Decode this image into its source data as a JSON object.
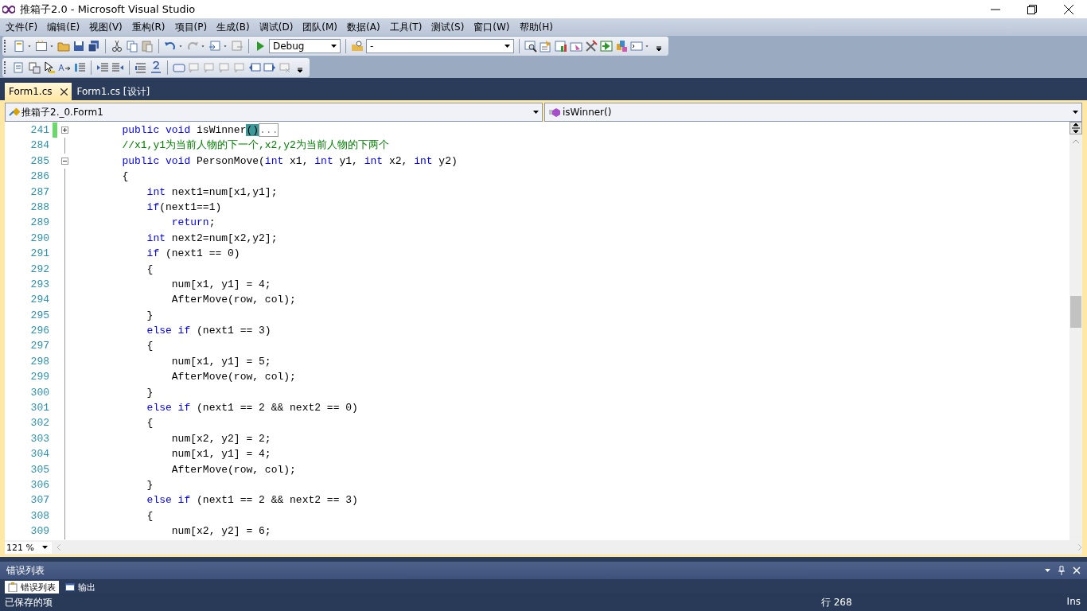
{
  "window": {
    "title": "推箱子2.0 - Microsoft Visual Studio"
  },
  "menu": [
    "文件(F)",
    "编辑(E)",
    "视图(V)",
    "重构(R)",
    "项目(P)",
    "生成(B)",
    "调试(D)",
    "团队(M)",
    "数据(A)",
    "工具(T)",
    "测试(S)",
    "窗口(W)",
    "帮助(H)"
  ],
  "toolbar": {
    "configuration": "Debug",
    "platform": "-"
  },
  "tabs": [
    {
      "label": "Form1.cs",
      "selected": true
    },
    {
      "label": "Form1.cs [设计]",
      "selected": false
    }
  ],
  "navigation": {
    "type": "推箱子2._0.Form1",
    "member": "isWinner()"
  },
  "editor": {
    "lines": [
      {
        "number": "241",
        "changed": true,
        "outlining": true,
        "expanded": false,
        "tokens": [
          {
            "kind": "keyword",
            "text": "        public void"
          },
          {
            "kind": "plain",
            "text": " isWinner"
          },
          {
            "kind": "match",
            "text": "()"
          },
          {
            "kind": "collapsed",
            "text": "..."
          }
        ]
      },
      {
        "number": "284",
        "changed": false,
        "outlining": false,
        "tokens": [
          {
            "kind": "comment",
            "text": "        //x1,y1为当前人物的下一个,x2,y2为当前人物的下两个"
          }
        ]
      },
      {
        "number": "285",
        "changed": false,
        "outlining": true,
        "expanded": true,
        "tokens": [
          {
            "kind": "keyword",
            "text": "        public void"
          },
          {
            "kind": "plain",
            "text": " PersonMove("
          },
          {
            "kind": "keyword",
            "text": "int"
          },
          {
            "kind": "plain",
            "text": " x1, "
          },
          {
            "kind": "keyword",
            "text": "int"
          },
          {
            "kind": "plain",
            "text": " y1, "
          },
          {
            "kind": "keyword",
            "text": "int"
          },
          {
            "kind": "plain",
            "text": " x2, "
          },
          {
            "kind": "keyword",
            "text": "int"
          },
          {
            "kind": "plain",
            "text": " y2)"
          }
        ]
      },
      {
        "number": "286",
        "changed": false,
        "outlining": false,
        "tokens": [
          {
            "kind": "plain",
            "text": "        {"
          }
        ]
      },
      {
        "number": "287",
        "changed": false,
        "outlining": false,
        "tokens": [
          {
            "kind": "keyword",
            "text": "            int"
          },
          {
            "kind": "plain",
            "text": " next1=num[x1,y1];"
          }
        ]
      },
      {
        "number": "288",
        "changed": false,
        "outlining": false,
        "tokens": [
          {
            "kind": "keyword",
            "text": "            if"
          },
          {
            "kind": "plain",
            "text": "(next1==1)"
          }
        ]
      },
      {
        "number": "289",
        "changed": false,
        "outlining": false,
        "tokens": [
          {
            "kind": "keyword",
            "text": "                return"
          },
          {
            "kind": "plain",
            "text": ";"
          }
        ]
      },
      {
        "number": "290",
        "changed": false,
        "outlining": false,
        "tokens": [
          {
            "kind": "keyword",
            "text": "            int"
          },
          {
            "kind": "plain",
            "text": " next2=num[x2,y2];"
          }
        ]
      },
      {
        "number": "291",
        "changed": false,
        "outlining": false,
        "tokens": [
          {
            "kind": "keyword",
            "text": "            if"
          },
          {
            "kind": "plain",
            "text": " (next1 == 0)"
          }
        ]
      },
      {
        "number": "292",
        "changed": false,
        "outlining": false,
        "tokens": [
          {
            "kind": "plain",
            "text": "            {"
          }
        ]
      },
      {
        "number": "293",
        "changed": false,
        "outlining": false,
        "tokens": [
          {
            "kind": "plain",
            "text": "                num[x1, y1] = 4;"
          }
        ]
      },
      {
        "number": "294",
        "changed": false,
        "outlining": false,
        "tokens": [
          {
            "kind": "plain",
            "text": "                AfterMove(row, col);"
          }
        ]
      },
      {
        "number": "295",
        "changed": false,
        "outlining": false,
        "tokens": [
          {
            "kind": "plain",
            "text": "            }"
          }
        ]
      },
      {
        "number": "296",
        "changed": false,
        "outlining": false,
        "tokens": [
          {
            "kind": "keyword",
            "text": "            else if"
          },
          {
            "kind": "plain",
            "text": " (next1 == 3)"
          }
        ]
      },
      {
        "number": "297",
        "changed": false,
        "outlining": false,
        "tokens": [
          {
            "kind": "plain",
            "text": "            {"
          }
        ]
      },
      {
        "number": "298",
        "changed": false,
        "outlining": false,
        "tokens": [
          {
            "kind": "plain",
            "text": "                num[x1, y1] = 5;"
          }
        ]
      },
      {
        "number": "299",
        "changed": false,
        "outlining": false,
        "tokens": [
          {
            "kind": "plain",
            "text": "                AfterMove(row, col);"
          }
        ]
      },
      {
        "number": "300",
        "changed": false,
        "outlining": false,
        "tokens": [
          {
            "kind": "plain",
            "text": "            }"
          }
        ]
      },
      {
        "number": "301",
        "changed": false,
        "outlining": false,
        "tokens": [
          {
            "kind": "keyword",
            "text": "            else if"
          },
          {
            "kind": "plain",
            "text": " (next1 == 2 && next2 == 0)"
          }
        ]
      },
      {
        "number": "302",
        "changed": false,
        "outlining": false,
        "tokens": [
          {
            "kind": "plain",
            "text": "            {"
          }
        ]
      },
      {
        "number": "303",
        "changed": false,
        "outlining": false,
        "tokens": [
          {
            "kind": "plain",
            "text": "                num[x2, y2] = 2;"
          }
        ]
      },
      {
        "number": "304",
        "changed": false,
        "outlining": false,
        "tokens": [
          {
            "kind": "plain",
            "text": "                num[x1, y1] = 4;"
          }
        ]
      },
      {
        "number": "305",
        "changed": false,
        "outlining": false,
        "tokens": [
          {
            "kind": "plain",
            "text": "                AfterMove(row, col);"
          }
        ]
      },
      {
        "number": "306",
        "changed": false,
        "outlining": false,
        "tokens": [
          {
            "kind": "plain",
            "text": "            }"
          }
        ]
      },
      {
        "number": "307",
        "changed": false,
        "outlining": false,
        "tokens": [
          {
            "kind": "keyword",
            "text": "            else if"
          },
          {
            "kind": "plain",
            "text": " (next1 == 2 && next2 == 3)"
          }
        ]
      },
      {
        "number": "308",
        "changed": false,
        "outlining": false,
        "tokens": [
          {
            "kind": "plain",
            "text": "            {"
          }
        ]
      },
      {
        "number": "309",
        "changed": false,
        "outlining": false,
        "tokens": [
          {
            "kind": "plain",
            "text": "                num[x2, y2] = 6;"
          }
        ]
      }
    ],
    "zoom": "121 %"
  },
  "panel": {
    "title": "错误列表",
    "tabs": [
      {
        "label": "错误列表",
        "selected": true
      },
      {
        "label": "输出",
        "selected": false
      }
    ]
  },
  "status_bar": {
    "message": "已保存的项",
    "line": "行 268",
    "mode": "Ins"
  }
}
